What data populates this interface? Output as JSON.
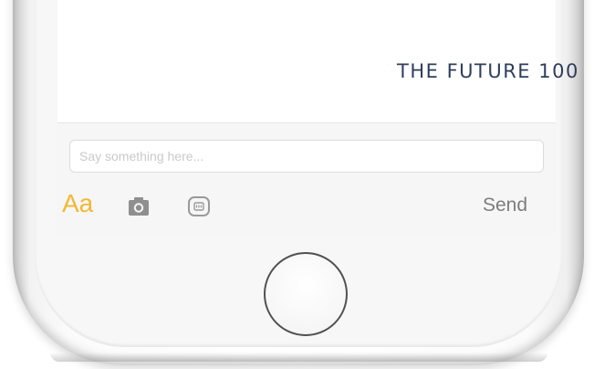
{
  "screen": {
    "banner_text": "THE FUTURE 100"
  },
  "composer": {
    "placeholder": "Say something here...",
    "format_label": "Aa",
    "send_label": "Send",
    "icons": {
      "camera": "camera-icon",
      "sticker": "sticker-icon"
    }
  },
  "colors": {
    "accent": "#f2b833",
    "send": "#7d7d7d",
    "banner": "#2f3e5a"
  }
}
